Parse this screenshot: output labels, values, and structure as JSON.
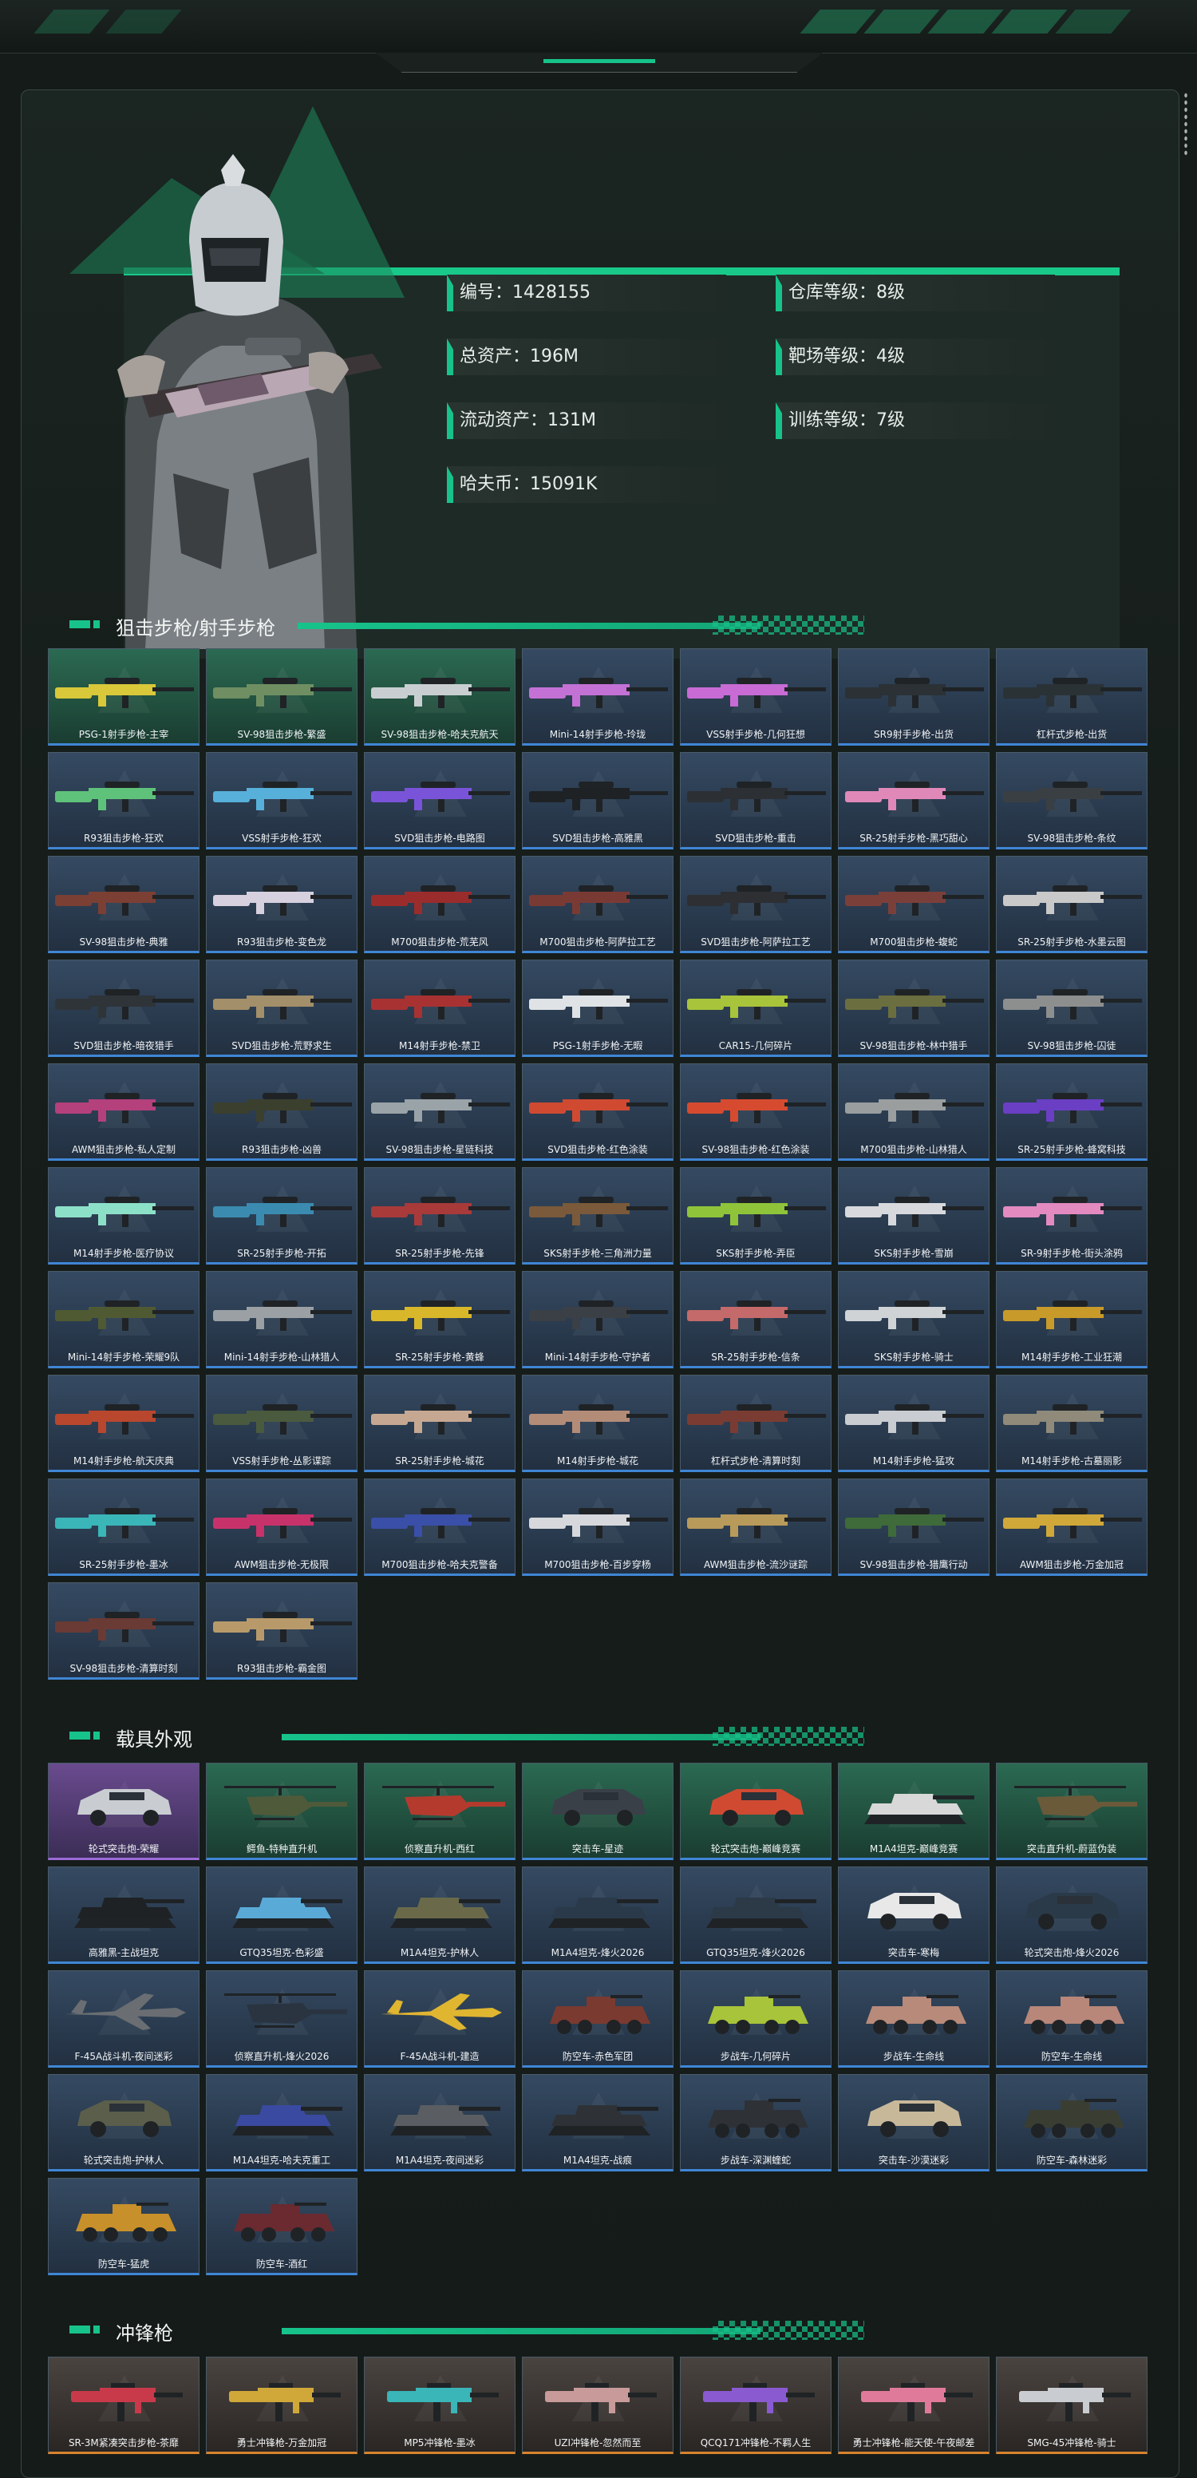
{
  "profile": {
    "stats_left": [
      {
        "label": "编号：1428155"
      },
      {
        "label": "总资产：196M"
      },
      {
        "label": "流动资产：131M"
      },
      {
        "label": "哈夫币：15091K"
      }
    ],
    "stats_right": [
      {
        "label": "仓库等级：8级"
      },
      {
        "label": "靶场等级：4级"
      },
      {
        "label": "训练等级：7级"
      }
    ]
  },
  "sections": [
    {
      "title": "狙击步枪/射手步枪",
      "items": [
        {
          "name": "PSG-1射手步枪-主宰",
          "tone": "green",
          "art": "rifle",
          "color": "#d8c83a"
        },
        {
          "name": "SV-98狙击步枪-繁盛",
          "tone": "green",
          "art": "rifle",
          "color": "#6f8f62"
        },
        {
          "name": "SV-98狙击步枪-哈夫克航天",
          "tone": "green",
          "art": "rifle",
          "color": "#c9cfd1"
        },
        {
          "name": "Mini-14射手步枪-玲珑",
          "tone": "blue",
          "art": "rifle",
          "color": "#c471d6"
        },
        {
          "name": "VSS射手步枪-几何狂想",
          "tone": "blue",
          "art": "rifle",
          "color": "#c86bd4"
        },
        {
          "name": "SR9射手步枪-出货",
          "tone": "blue",
          "art": "rifle",
          "color": "#2b3135"
        },
        {
          "name": "杠杆式步枪-出货",
          "tone": "blue",
          "art": "rifle",
          "color": "#2a3236"
        },
        {
          "name": "R93狙击步枪-狂欢",
          "tone": "blue",
          "art": "rifle",
          "color": "#5fc27a"
        },
        {
          "name": "VSS射手步枪-狂欢",
          "tone": "blue",
          "art": "rifle",
          "color": "#57b0d9"
        },
        {
          "name": "SVD狙击步枪-电路图",
          "tone": "blue",
          "art": "rifle",
          "color": "#7a54d8"
        },
        {
          "name": "SVD狙击步枪-高雅黑",
          "tone": "blue",
          "art": "rifle",
          "color": "#1e2225"
        },
        {
          "name": "SVD狙击步枪-重击",
          "tone": "blue",
          "art": "rifle",
          "color": "#2c3034"
        },
        {
          "name": "SR-25射手步枪-黑巧甜心",
          "tone": "blue",
          "art": "rifle",
          "color": "#e089b8"
        },
        {
          "name": "SV-98狙击步枪-条纹",
          "tone": "blue",
          "art": "rifle",
          "color": "#3a3f44"
        },
        {
          "name": "SV-98狙击步枪-典雅",
          "tone": "blue",
          "art": "rifle",
          "color": "#7b3f33"
        },
        {
          "name": "R93狙击步枪-变色龙",
          "tone": "blue",
          "art": "rifle",
          "color": "#d6d0df"
        },
        {
          "name": "M700狙击步枪-荒芜风",
          "tone": "blue",
          "art": "rifle",
          "color": "#9a2c2c"
        },
        {
          "name": "M700狙击步枪-阿萨拉工艺",
          "tone": "blue",
          "art": "rifle",
          "color": "#7a3a34"
        },
        {
          "name": "SVD狙击步枪-阿萨拉工艺",
          "tone": "blue",
          "art": "rifle",
          "color": "#2d2f33"
        },
        {
          "name": "M700狙击步枪-蝮蛇",
          "tone": "blue",
          "art": "rifle",
          "color": "#7b3f3a"
        },
        {
          "name": "SR-25射手步枪-水墨云图",
          "tone": "blue",
          "art": "rifle",
          "color": "#c9c9c9"
        },
        {
          "name": "SVD狙击步枪-暗夜猎手",
          "tone": "blue",
          "art": "rifle",
          "color": "#2f3438"
        },
        {
          "name": "SVD狙击步枪-荒野求生",
          "tone": "blue",
          "art": "rifle",
          "color": "#a38f69"
        },
        {
          "name": "M14射手步枪-禁卫",
          "tone": "blue",
          "art": "rifle",
          "color": "#a83232"
        },
        {
          "name": "PSG-1射手步枪-无暇",
          "tone": "blue",
          "art": "rifle",
          "color": "#dfe3e6"
        },
        {
          "name": "CAR15-几何碎片",
          "tone": "blue",
          "art": "rifle",
          "color": "#a8c43a"
        },
        {
          "name": "SV-98狙击步枪-林中猎手",
          "tone": "blue",
          "art": "rifle",
          "color": "#6b6e3f"
        },
        {
          "name": "SV-98狙击步枪-囚徒",
          "tone": "blue",
          "art": "rifle",
          "color": "#8d8f8f"
        },
        {
          "name": "AWM狙击步枪-私人定制",
          "tone": "blue",
          "art": "rifle",
          "color": "#b4407c"
        },
        {
          "name": "R93狙击步枪-凶兽",
          "tone": "blue",
          "art": "rifle",
          "color": "#3b3f2e"
        },
        {
          "name": "SV-98狙击步枪-星链科技",
          "tone": "blue",
          "art": "rifle",
          "color": "#9aa3a8"
        },
        {
          "name": "SVD狙击步枪-红色涂装",
          "tone": "blue",
          "art": "rifle",
          "color": "#d04a32"
        },
        {
          "name": "SV-98狙击步枪-红色涂装",
          "tone": "blue",
          "art": "rifle",
          "color": "#d64b2f"
        },
        {
          "name": "M700狙击步枪-山林猎人",
          "tone": "blue",
          "art": "rifle",
          "color": "#9a9e9f"
        },
        {
          "name": "SR-25射手步枪-蜂窝科技",
          "tone": "blue",
          "art": "rifle",
          "color": "#6a3fc4"
        },
        {
          "name": "M14射手步枪-医疗协议",
          "tone": "blue",
          "art": "rifle",
          "color": "#8de0c8"
        },
        {
          "name": "SR-25射手步枪-开拓",
          "tone": "blue",
          "art": "rifle",
          "color": "#3b8bb0"
        },
        {
          "name": "SR-25射手步枪-先锋",
          "tone": "blue",
          "art": "rifle",
          "color": "#a83a3a"
        },
        {
          "name": "SKS射手步枪-三角洲力量",
          "tone": "blue",
          "art": "rifle",
          "color": "#7a5a3a"
        },
        {
          "name": "SKS射手步枪-弄臣",
          "tone": "blue",
          "art": "rifle",
          "color": "#8fc43a"
        },
        {
          "name": "SKS射手步枪-雪崩",
          "tone": "blue",
          "art": "rifle",
          "color": "#d7d9dc"
        },
        {
          "name": "SR-9射手步枪-街头涂鸦",
          "tone": "blue",
          "art": "rifle",
          "color": "#e38ac0"
        },
        {
          "name": "Mini-14射手步枪-荣耀9队",
          "tone": "blue",
          "art": "rifle",
          "color": "#4f5a33"
        },
        {
          "name": "Mini-14射手步枪-山林猎人",
          "tone": "blue",
          "art": "rifle",
          "color": "#9aa0a3"
        },
        {
          "name": "SR-25射手步枪-黄蜂",
          "tone": "blue",
          "art": "rifle",
          "color": "#d8b82a"
        },
        {
          "name": "Mini-14射手步枪-守护者",
          "tone": "blue",
          "art": "rifle",
          "color": "#3b4046"
        },
        {
          "name": "SR-25射手步枪-信条",
          "tone": "blue",
          "art": "rifle",
          "color": "#c46a6a"
        },
        {
          "name": "SKS射手步枪-骑士",
          "tone": "blue",
          "art": "rifle",
          "color": "#cfd3d6"
        },
        {
          "name": "M14射手步枪-工业狂潮",
          "tone": "blue",
          "art": "rifle",
          "color": "#c79a2a"
        },
        {
          "name": "M14射手步枪-航天庆典",
          "tone": "blue",
          "art": "rifle",
          "color": "#b8472e"
        },
        {
          "name": "VSS射手步枪-丛影谍踪",
          "tone": "blue",
          "art": "rifle",
          "color": "#4a5a3e"
        },
        {
          "name": "SR-25射手步枪-城花",
          "tone": "blue",
          "art": "rifle",
          "color": "#c6a892"
        },
        {
          "name": "M14射手步枪-城花",
          "tone": "blue",
          "art": "rifle",
          "color": "#b38c78"
        },
        {
          "name": "杠杆式步枪-清算时刻",
          "tone": "blue",
          "art": "rifle",
          "color": "#7a3c32"
        },
        {
          "name": "M14射手步枪-猛攻",
          "tone": "blue",
          "art": "rifle",
          "color": "#c9ccd0"
        },
        {
          "name": "M14射手步枪-古墓丽影",
          "tone": "blue",
          "art": "rifle",
          "color": "#8f8a7a"
        },
        {
          "name": "SR-25射手步枪-墨冰",
          "tone": "blue",
          "art": "rifle",
          "color": "#3ab5b8"
        },
        {
          "name": "AWM狙击步枪-无极限",
          "tone": "blue",
          "art": "rifle",
          "color": "#c8326a"
        },
        {
          "name": "M700狙击步枪-哈夫克警备",
          "tone": "blue",
          "art": "rifle",
          "color": "#3a4fa8"
        },
        {
          "name": "M700狙击步枪-百步穿杨",
          "tone": "blue",
          "art": "rifle",
          "color": "#d6d8dc"
        },
        {
          "name": "AWM狙击步枪-流沙谜踪",
          "tone": "blue",
          "art": "rifle",
          "color": "#b89a5a"
        },
        {
          "name": "SV-98狙击步枪-猎鹰行动",
          "tone": "blue",
          "art": "rifle",
          "color": "#3f6a3a"
        },
        {
          "name": "AWM狙击步枪-万金加冠",
          "tone": "blue",
          "art": "rifle",
          "color": "#d0a83a"
        },
        {
          "name": "SV-98狙击步枪-清算时刻",
          "tone": "blue",
          "art": "rifle",
          "color": "#6a3a34"
        },
        {
          "name": "R93狙击步枪-霸金图",
          "tone": "blue",
          "art": "rifle",
          "color": "#b89a6a"
        }
      ]
    },
    {
      "title": "载具外观",
      "items": [
        {
          "name": "轮式突击炮-荣耀",
          "tone": "purple",
          "art": "car",
          "color": "#c9cdd2"
        },
        {
          "name": "鳄鱼-特种直升机",
          "tone": "green",
          "art": "heli",
          "color": "#4f5a3a"
        },
        {
          "name": "侦察直升机-西红",
          "tone": "green",
          "art": "heli",
          "color": "#b53a2e"
        },
        {
          "name": "突击车-星迹",
          "tone": "green",
          "art": "car",
          "color": "#3a4048"
        },
        {
          "name": "轮式突击炮-巅峰竞赛",
          "tone": "green",
          "art": "car",
          "color": "#d04a32"
        },
        {
          "name": "M1A4坦克-巅峰竞赛",
          "tone": "green",
          "art": "tank",
          "color": "#d8d8d8"
        },
        {
          "name": "突击直升机-蔚蓝伪装",
          "tone": "green",
          "art": "heli",
          "color": "#6a5a3a"
        },
        {
          "name": "高雅黑-主战坦克",
          "tone": "blue",
          "art": "tank",
          "color": "#1e2225"
        },
        {
          "name": "GTQ35坦克-色彩盛",
          "tone": "blue",
          "art": "tank",
          "color": "#5aaad8"
        },
        {
          "name": "M1A4坦克-护林人",
          "tone": "blue",
          "art": "tank",
          "color": "#6a6a4a"
        },
        {
          "name": "M1A4坦克-烽火2026",
          "tone": "blue",
          "art": "tank",
          "color": "#2a3a4a"
        },
        {
          "name": "GTQ35坦克-烽火2026",
          "tone": "blue",
          "art": "tank",
          "color": "#2c3a48"
        },
        {
          "name": "突击车-寒梅",
          "tone": "blue",
          "art": "car",
          "color": "#e8e8e8"
        },
        {
          "name": "轮式突击炮-烽火2026",
          "tone": "blue",
          "art": "car",
          "color": "#2a3a48"
        },
        {
          "name": "F-45A战斗机-夜间迷彩",
          "tone": "blue",
          "art": "jet",
          "color": "#6a6e72"
        },
        {
          "name": "侦察直升机-烽火2026",
          "tone": "blue",
          "art": "heli",
          "color": "#2a3440"
        },
        {
          "name": "F-45A战斗机-建造",
          "tone": "blue",
          "art": "jet",
          "color": "#e0b530"
        },
        {
          "name": "防空车-赤色军团",
          "tone": "blue",
          "art": "apc",
          "color": "#7a3a30"
        },
        {
          "name": "步战车-几何碎片",
          "tone": "blue",
          "art": "apc",
          "color": "#a8c43a"
        },
        {
          "name": "步战车-生命线",
          "tone": "blue",
          "art": "apc",
          "color": "#b88a7a"
        },
        {
          "name": "防空车-生命线",
          "tone": "blue",
          "art": "apc",
          "color": "#b8877a"
        },
        {
          "name": "轮式突击炮-护林人",
          "tone": "blue",
          "art": "car",
          "color": "#5a5e4a"
        },
        {
          "name": "M1A4坦克-哈夫克重工",
          "tone": "blue",
          "art": "tank",
          "color": "#3a4aa0"
        },
        {
          "name": "M1A4坦克-夜间迷彩",
          "tone": "blue",
          "art": "tank",
          "color": "#5a5e62"
        },
        {
          "name": "M1A4坦克-战痕",
          "tone": "blue",
          "art": "tank",
          "color": "#2e3236"
        },
        {
          "name": "步战车-深渊蝰蛇",
          "tone": "blue",
          "art": "apc",
          "color": "#2e3236"
        },
        {
          "name": "突击车-沙漠迷彩",
          "tone": "blue",
          "art": "car",
          "color": "#c8b89a"
        },
        {
          "name": "防空车-森林迷彩",
          "tone": "blue",
          "art": "apc",
          "color": "#3a3e32"
        },
        {
          "name": "防空车-猛虎",
          "tone": "blue",
          "art": "apc",
          "color": "#c8902a"
        },
        {
          "name": "防空车-酒红",
          "tone": "blue",
          "art": "apc",
          "color": "#6a2a30"
        }
      ]
    },
    {
      "title": "冲锋枪",
      "items": [
        {
          "name": "SR-3M紧凑突击步枪-茶靡",
          "tone": "orange",
          "art": "smg",
          "color": "#c83a4a"
        },
        {
          "name": "勇士冲锋枪-万金加冠",
          "tone": "orange",
          "art": "smg",
          "color": "#d0a83a"
        },
        {
          "name": "MP5冲锋枪-墨冰",
          "tone": "orange",
          "art": "smg",
          "color": "#3ab5b8"
        },
        {
          "name": "UZI冲锋枪-忽然而至",
          "tone": "orange",
          "art": "smg",
          "color": "#c89a9a"
        },
        {
          "name": "QCQ171冲锋枪-不羁人生",
          "tone": "orange",
          "art": "smg",
          "color": "#8a5ad0"
        },
        {
          "name": "勇士冲锋枪-能天使-午夜邮差",
          "tone": "orange",
          "art": "smg",
          "color": "#e07a9a"
        },
        {
          "name": "SMG-45冲锋枪-骑士",
          "tone": "orange",
          "art": "smg",
          "color": "#c9ccd0"
        }
      ]
    }
  ]
}
